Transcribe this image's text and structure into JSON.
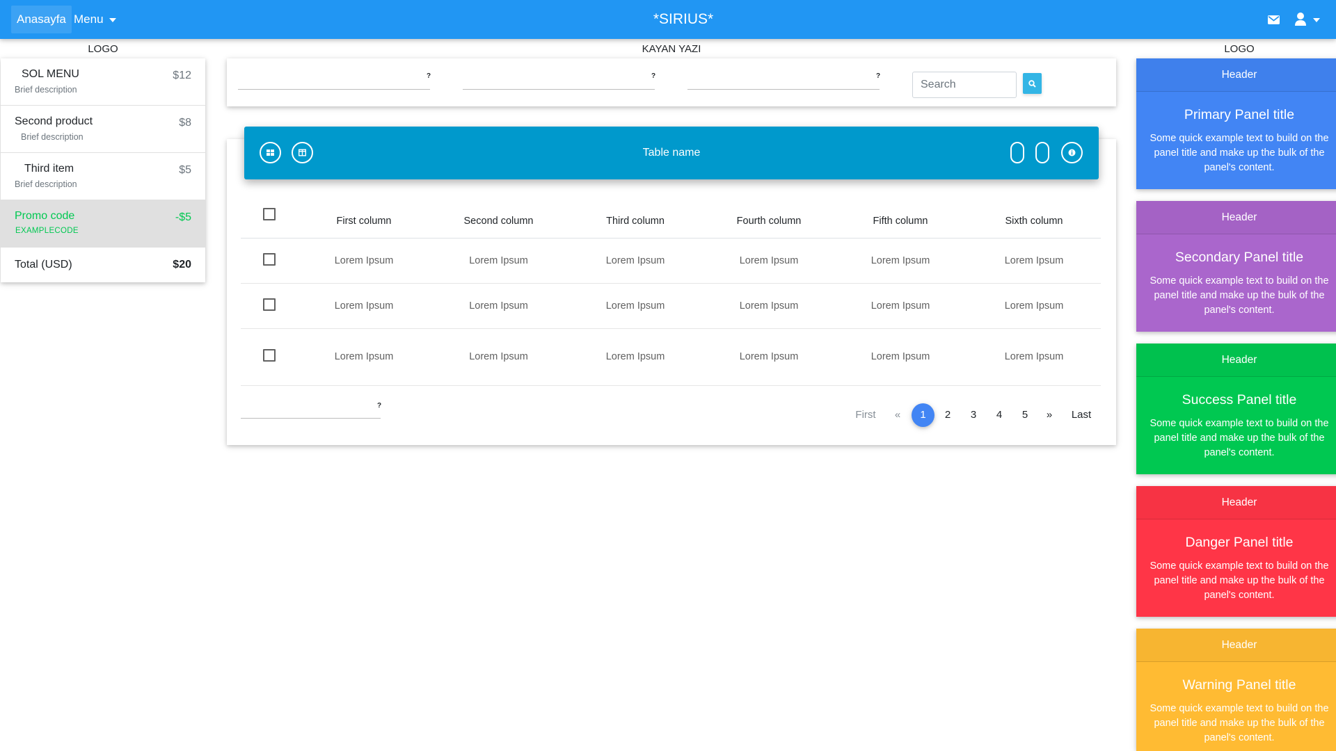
{
  "nav": {
    "home": "Anasayfa",
    "menu": "Menu",
    "brand": "*SIRIUS*",
    "icons": [
      "envelope-icon",
      "user-icon"
    ]
  },
  "captions": {
    "left_logo": "LOGO",
    "marquee": "KAYAN YAZI",
    "right_logo": "LOGO"
  },
  "cart": {
    "items": [
      {
        "name": "SOL MENU",
        "desc": "Brief description",
        "price": "$12"
      },
      {
        "name": "Second product",
        "desc": "Brief description",
        "price": "$8"
      },
      {
        "name": "Third item",
        "desc": "Brief description",
        "price": "$5"
      }
    ],
    "promo": {
      "name": "Promo code",
      "code": "EXAMPLECODE",
      "price": "-$5"
    },
    "total": {
      "label": "Total (USD)",
      "value": "$20"
    }
  },
  "filter": {
    "help": "?",
    "search_placeholder": "Search"
  },
  "table": {
    "name": "Table name",
    "columns": [
      "First column",
      "Second column",
      "Third column",
      "Fourth column",
      "Fifth column",
      "Sixth column"
    ],
    "rows": [
      [
        "Lorem Ipsum",
        "Lorem Ipsum",
        "Lorem Ipsum",
        "Lorem Ipsum",
        "Lorem Ipsum",
        "Lorem Ipsum"
      ],
      [
        "Lorem Ipsum",
        "Lorem Ipsum",
        "Lorem Ipsum",
        "Lorem Ipsum",
        "Lorem Ipsum",
        "Lorem Ipsum"
      ],
      [
        "Lorem Ipsum",
        "Lorem Ipsum",
        "Lorem Ipsum",
        "Lorem Ipsum",
        "Lorem Ipsum",
        "Lorem Ipsum"
      ]
    ]
  },
  "pagination": {
    "help": "?",
    "first": "First",
    "prev": "«",
    "pages": [
      "1",
      "2",
      "3",
      "4",
      "5"
    ],
    "next": "»",
    "last": "Last",
    "active": "1"
  },
  "panels": [
    {
      "header": "Header",
      "title": "Primary Panel title",
      "text": "Some quick example text to build on the panel title and make up the bulk of the panel's content.",
      "color": "#4285f4"
    },
    {
      "header": "Header",
      "title": "Secondary Panel title",
      "text": "Some quick example text to build on the panel title and make up the bulk of the panel's content.",
      "color": "#aa66cc"
    },
    {
      "header": "Header",
      "title": "Success Panel title",
      "text": "Some quick example text to build on the panel title and make up the bulk of the panel's content.",
      "color": "#00c851"
    },
    {
      "header": "Header",
      "title": "Danger Panel title",
      "text": "Some quick example text to build on the panel title and make up the bulk of the panel's content.",
      "color": "#ff3547"
    },
    {
      "header": "Header",
      "title": "Warning Panel title",
      "text": "Some quick example text to build on the panel title and make up the bulk of the panel's content.",
      "color": "#ffbb33"
    }
  ],
  "colors": {
    "navbar": "#2196f3",
    "table_header": "#0099cc",
    "search_button": "#33b5e5",
    "promo": "#00c851",
    "active_page": "#4285f4"
  }
}
